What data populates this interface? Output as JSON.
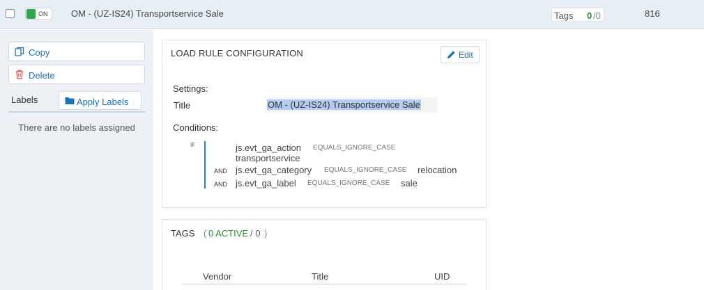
{
  "row": {
    "toggle_label": "ON",
    "title": "OM - (UZ-IS24) Transportservice Sale",
    "tags_label": "Tags",
    "tags_active": "0",
    "tags_sep": "/",
    "tags_total": "0",
    "count": "816"
  },
  "sidebar": {
    "copy_label": "Copy",
    "delete_label": "Delete",
    "labels_heading": "Labels",
    "apply_labels": "Apply Labels",
    "no_labels": "There are no labels assigned"
  },
  "rule": {
    "heading": "LOAD RULE CONFIGURATION",
    "edit_label": "Edit",
    "settings_heading": "Settings:",
    "title_label": "Title",
    "title_value": "OM - (UZ-IS24) Transportservice Sale",
    "conditions_heading": "Conditions:",
    "if_label": "IF",
    "conditions": [
      {
        "op": "",
        "variable": "js.evt_ga_action",
        "comparator": "EQUALS_IGNORE_CASE",
        "value": "transportservice"
      },
      {
        "op": "AND",
        "variable": "js.evt_ga_category",
        "comparator": "EQUALS_IGNORE_CASE",
        "value": "relocation"
      },
      {
        "op": "AND",
        "variable": "js.evt_ga_label",
        "comparator": "EQUALS_IGNORE_CASE",
        "value": "sale"
      }
    ]
  },
  "tags_section": {
    "heading": "TAGS",
    "paren_open": "(",
    "active": "0 ACTIVE",
    "total": "/ 0",
    "paren_close": ")",
    "columns": [
      "Vendor",
      "Title",
      "UID"
    ]
  },
  "colors": {
    "accent": "#1a73b8",
    "on_green": "#2ea84a",
    "active_green": "#2e8b2e",
    "condition_bar": "#2f7fc4",
    "selection": "#b3cdf0",
    "delete_red": "#d9534f"
  },
  "icons": {
    "copy": "copy-icon",
    "delete": "trash-icon",
    "apply": "folder-icon",
    "edit": "pencil-icon"
  }
}
